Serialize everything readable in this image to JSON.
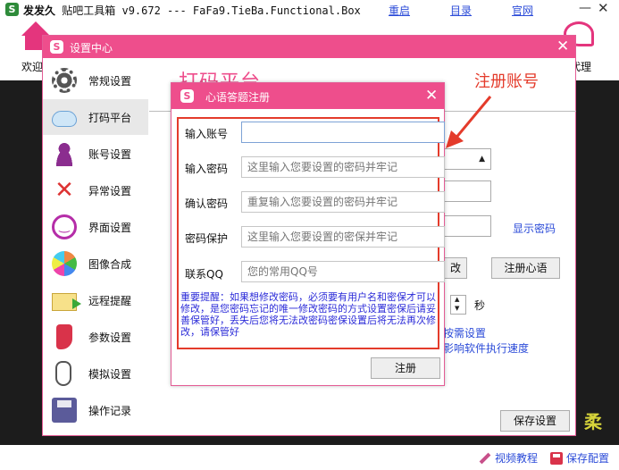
{
  "main_window": {
    "logo_glyph": "S",
    "title_main": "发发久",
    "title_rest": " 贴吧工具箱 v9.672 --- FaFa9.TieBa.Functional.Box",
    "links": {
      "restart": "重启",
      "directory": "目录",
      "website": "官网"
    },
    "minimize": "—",
    "close": "✕"
  },
  "toolbar": {
    "home_label": "欢迎",
    "right_label": "代理"
  },
  "settings_window": {
    "logo_glyph": "S",
    "title": "设置中心",
    "close": "✕",
    "nav": [
      {
        "label": "常规设置",
        "icon": "gear-icon"
      },
      {
        "label": "打码平台",
        "icon": "cloud-icon",
        "active": true
      },
      {
        "label": "账号设置",
        "icon": "person-icon"
      },
      {
        "label": "异常设置",
        "icon": "x-icon"
      },
      {
        "label": "界面设置",
        "icon": "smiley-icon"
      },
      {
        "label": "图像合成",
        "icon": "petals-icon"
      },
      {
        "label": "远程提醒",
        "icon": "mail-icon"
      },
      {
        "label": "参数设置",
        "icon": "sock-icon"
      },
      {
        "label": "模拟设置",
        "icon": "mouse-icon"
      },
      {
        "label": "操作记录",
        "icon": "floppy-icon"
      }
    ],
    "content": {
      "heading": "打码平台",
      "show_password": "显示密码",
      "modify_button": "改",
      "register_heart_button": "注册心语",
      "seconds_unit": "秒",
      "link_1": "按需设置",
      "link_2": "影响软件执行速度",
      "save_button": "保存设置"
    }
  },
  "annotation": {
    "text": "注册账号"
  },
  "registration_dialog": {
    "logo_glyph": "S",
    "title": "心语答题注册",
    "close": "✕",
    "fields": {
      "account": {
        "label": "输入账号",
        "value": "",
        "placeholder": ""
      },
      "password": {
        "label": "输入密码",
        "placeholder": "这里输入您要设置的密码并牢记"
      },
      "confirm": {
        "label": "确认密码",
        "placeholder": "重复输入您要设置的密码并牢记"
      },
      "protection": {
        "label": "密码保护",
        "placeholder": "这里输入您要设置的密保并牢记"
      },
      "qq": {
        "label": "联系QQ",
        "placeholder": "您的常用QQ号"
      }
    },
    "notice": "重要提醒：如果想修改密码，必须要有用户名和密保才可以修改，是您密码忘记的唯一修改密码的方式设置密保后请妥善保管好，丢失后您将无法改密码密保设置后将无法再次修改，请保管好",
    "submit": "注册"
  },
  "bottom_bar": {
    "video_tutorial": "视频教程",
    "save_config": "保存配置"
  },
  "dark_area": {
    "glyph": "柔"
  },
  "colors": {
    "accent_pink": "#ee4e8c",
    "annotation_red": "#e43b2b",
    "link_blue": "#2b4bd8"
  }
}
